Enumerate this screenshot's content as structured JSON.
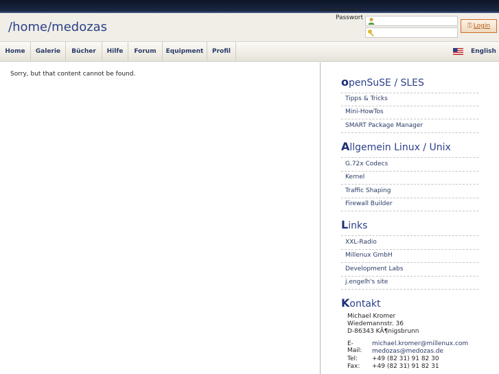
{
  "site": {
    "title": "/home/medozas"
  },
  "login": {
    "username_label": "Benutzername",
    "password_label": "Passwort",
    "username_value": "",
    "password_value": "",
    "button_label": "Login"
  },
  "nav": {
    "items": [
      "Home",
      "Galerie",
      "Bücher",
      "Hilfe",
      "Forum",
      "Equipment",
      "Profil"
    ],
    "language": "English"
  },
  "main": {
    "message": "Sorry, but that content cannot be found."
  },
  "sidebar": {
    "sections": [
      {
        "cap": "o",
        "rest": "penSuSE / SLES",
        "links": [
          "Tipps & Tricks",
          "Mini-HowTos",
          "SMART Package Manager"
        ]
      },
      {
        "cap": "A",
        "rest": "llgemein Linux / Unix",
        "links": [
          "G.72x Codecs",
          "Kernel",
          "Traffic Shaping",
          "Firewall Builder"
        ]
      },
      {
        "cap": "L",
        "rest": "inks",
        "links": [
          "XXL-Radio",
          "Millenux GmbH",
          "Development Labs",
          "j.engelh's site"
        ]
      }
    ],
    "contact": {
      "cap": "K",
      "rest": "ontakt",
      "name": "Michael Kromer",
      "street": "Wiedemannstr. 36",
      "city": "D-86343 KÃ¶nigsbrunn",
      "email_label": "E-Mail:",
      "email1": "michael.kromer@millenux.com",
      "email2": "medozas@medozas.de",
      "tel_label": "Tel:",
      "tel": "+49 (82 31) 91 82 30",
      "fax_label": "Fax:",
      "fax": "+49 (82 31) 91 82 31"
    }
  },
  "colors": {
    "accent": "#2b3f8a",
    "login_border": "#d36a2a",
    "topbar": "#0c1526"
  }
}
